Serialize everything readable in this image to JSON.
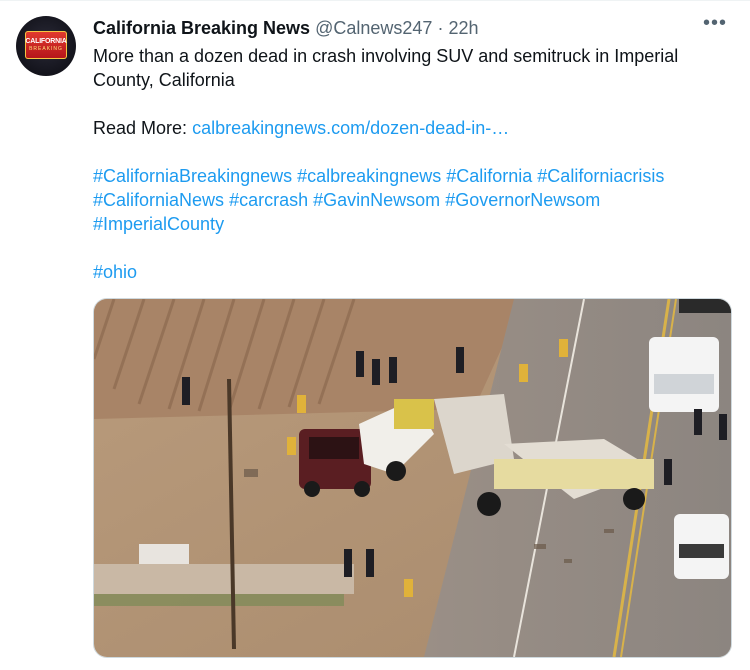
{
  "tweet": {
    "avatar_text": [
      "CALIFORNIA",
      "BREAKING"
    ],
    "author_name": "California Breaking News",
    "handle": "@Calnews247",
    "separator": "·",
    "time": "22h",
    "more_label": "•••",
    "text": "More than a dozen dead in crash involving SUV and semitruck in Imperial County, California",
    "read_more_label": "Read More:",
    "read_more_link": "calbreakingnews.com/dozen-dead-in-…",
    "hashtags_line1": [
      "#CaliforniaBreakingnews",
      "#calbreakingnews",
      "#California",
      "#Californiacrisis"
    ],
    "hashtags_line2": [
      "#CaliforniaNews",
      "#carcrash",
      "#GavinNewsom",
      "#GovernorNewsom"
    ],
    "hashtags_line3": [
      "#ImperialCounty"
    ],
    "extra_hashtag": "#ohio"
  },
  "colors": {
    "link": "#1d9bf0",
    "text": "#0f1419",
    "muted": "#536471",
    "border": "#cfd9de"
  },
  "media": {
    "description_icon": "photo"
  }
}
